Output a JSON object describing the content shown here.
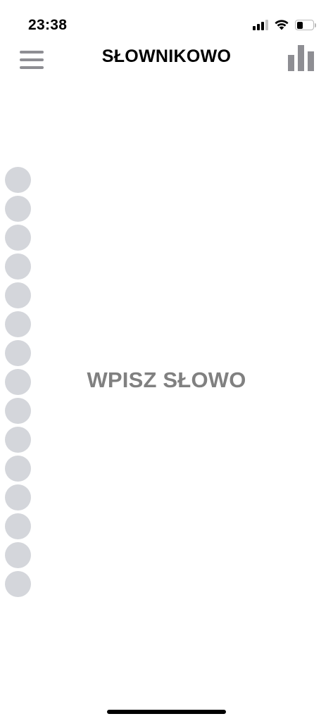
{
  "status_bar": {
    "time": "23:38",
    "signal_icon": "cellular-signal-icon",
    "wifi_icon": "wifi-icon",
    "battery_icon": "battery-icon",
    "battery_level": 0.4
  },
  "header": {
    "title": "SŁOWNIKOWO",
    "menu_icon": "hamburger-menu-icon",
    "stats_icon": "bar-chart-icon"
  },
  "letter_slots": {
    "count": 15,
    "color": "#d4d6db"
  },
  "main": {
    "prompt": "WPISZ SŁOWO"
  },
  "colors": {
    "icon_gray": "#8e8e93",
    "prompt_gray": "#808080"
  }
}
